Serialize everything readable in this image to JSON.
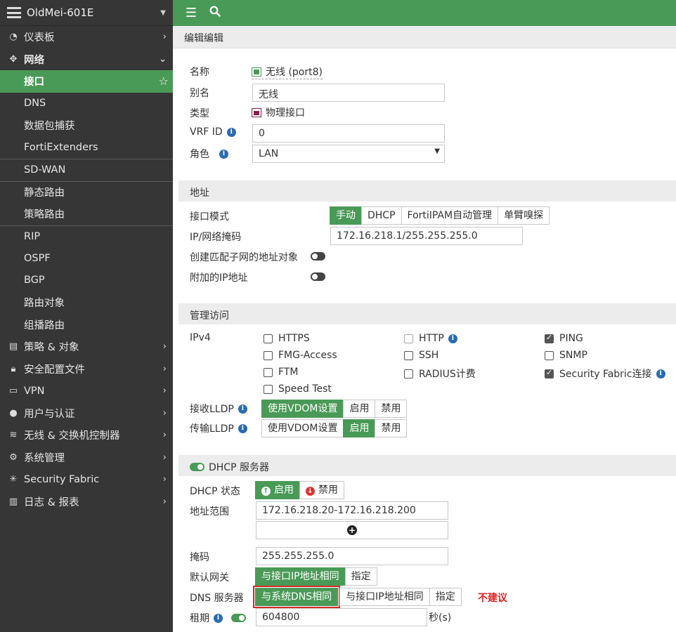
{
  "device": {
    "name": "OldMei-601E"
  },
  "sidebar": {
    "items": [
      {
        "label": "仪表板",
        "icon": "dashboard-icon"
      },
      {
        "label": "网络",
        "icon": "network-icon"
      },
      {
        "label": "接口"
      },
      {
        "label": "DNS"
      },
      {
        "label": "数据包捕获"
      },
      {
        "label": "FortiExtenders"
      },
      {
        "label": "SD-WAN"
      },
      {
        "label": "静态路由"
      },
      {
        "label": "策略路由"
      },
      {
        "label": "RIP"
      },
      {
        "label": "OSPF"
      },
      {
        "label": "BGP"
      },
      {
        "label": "路由对象"
      },
      {
        "label": "组播路由"
      },
      {
        "label": "策略 & 对象",
        "icon": "policy-icon"
      },
      {
        "label": "安全配置文件",
        "icon": "lock-icon"
      },
      {
        "label": "VPN",
        "icon": "laptop-icon"
      },
      {
        "label": "用户与认证",
        "icon": "user-icon"
      },
      {
        "label": "无线 & 交换机控制器",
        "icon": "wifi-icon"
      },
      {
        "label": "系统管理",
        "icon": "gear-icon"
      },
      {
        "label": "Security Fabric",
        "icon": "fabric-icon"
      },
      {
        "label": "日志 & 报表",
        "icon": "chart-icon"
      }
    ]
  },
  "page": {
    "title": "编辑编辑"
  },
  "form": {
    "name_label": "名称",
    "name_value": "无线 (port8)",
    "alias_label": "别名",
    "alias_value": "无线",
    "type_label": "类型",
    "type_value": "物理接口",
    "vrf_label": "VRF ID",
    "vrf_value": "0",
    "role_label": "角色",
    "role_value": "LAN"
  },
  "address": {
    "section": "地址",
    "mode_label": "接口模式",
    "modes": [
      "手动",
      "DHCP",
      "FortiIPAM自动管理",
      "单臂嗅探"
    ],
    "ip_label": "IP/网络掩码",
    "ip_value": "172.16.218.1/255.255.255.0",
    "subnet_obj_label": "创建匹配子网的地址对象",
    "secondary_label": "附加的IP地址"
  },
  "admin": {
    "section": "管理访问",
    "ipv4_label": "IPv4",
    "options": [
      {
        "label": "HTTPS",
        "checked": false
      },
      {
        "label": "HTTP",
        "checked": false
      },
      {
        "label": "PING",
        "checked": true
      },
      {
        "label": "FMG-Access",
        "checked": false
      },
      {
        "label": "SSH",
        "checked": false
      },
      {
        "label": "SNMP",
        "checked": false
      },
      {
        "label": "FTM",
        "checked": false
      },
      {
        "label": "RADIUS计费",
        "checked": false
      },
      {
        "label": "Security Fabric连接",
        "checked": true
      },
      {
        "label": "Speed Test",
        "checked": false
      }
    ],
    "lldp_rx_label": "接收LLDP",
    "lldp_tx_label": "传输LLDP",
    "lldp_options": [
      "使用VDOM设置",
      "启用",
      "禁用"
    ]
  },
  "dhcp": {
    "section": "DHCP 服务器",
    "status_label": "DHCP 状态",
    "status_on": "启用",
    "status_off": "禁用",
    "range_label": "地址范围",
    "range_value": "172.16.218.20-172.16.218.200",
    "mask_label": "掩码",
    "mask_value": "255.255.255.0",
    "gw_label": "默认网关",
    "gw_opt1": "与接口IP地址相同",
    "gw_opt2": "指定",
    "dns_label": "DNS 服务器",
    "dns_opt1": "与系统DNS相同",
    "dns_opt2": "与接口IP地址相同",
    "dns_opt3": "指定",
    "warning": "不建议",
    "lease_label": "租期",
    "lease_value": "604800",
    "lease_unit": "秒(s)"
  }
}
